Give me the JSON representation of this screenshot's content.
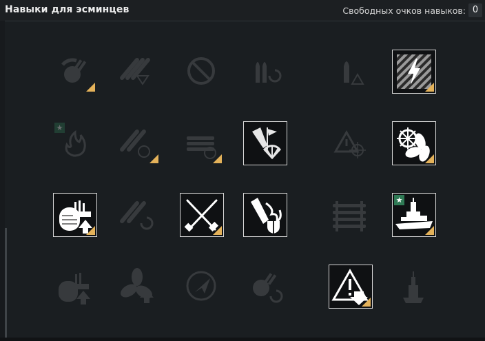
{
  "header": {
    "title": "Навыки для эсминцев",
    "points_label": "Свободных очков навыков:",
    "points_value": "0"
  },
  "colors": {
    "background": "#1a1e21",
    "learned_border": "#d9d9d9",
    "corner_marker": "#e4b25a",
    "star_badge": "#2f7a55"
  },
  "skills": [
    {
      "id": "r1c1",
      "icon": "aa-gunner-swing-icon",
      "learned": false,
      "corner": true,
      "star": false
    },
    {
      "id": "r1c2",
      "icon": "torpedo-triple-arrow-icon",
      "learned": false,
      "corner": false,
      "star": false
    },
    {
      "id": "r1c3",
      "icon": "prohibited-circle-icon",
      "learned": false,
      "corner": false,
      "star": false
    },
    {
      "id": "r1c4",
      "icon": "shells-reload-icon",
      "learned": false,
      "corner": false,
      "star": false
    },
    {
      "id": "r1c5",
      "icon": "shell-warning-icon",
      "learned": false,
      "corner": false,
      "star": false
    },
    {
      "id": "r1c6",
      "icon": "lightning-hazard-icon",
      "learned": true,
      "corner": true,
      "star": false
    },
    {
      "id": "r2c1",
      "icon": "fire-star-icon",
      "learned": false,
      "corner": false,
      "star": true
    },
    {
      "id": "r2c2",
      "icon": "torpedo-timer-icon",
      "learned": false,
      "corner": true,
      "star": false
    },
    {
      "id": "r2c3",
      "icon": "tubes-timer-icon",
      "learned": false,
      "corner": true,
      "star": false
    },
    {
      "id": "r2c4",
      "icon": "shell-flag-fan-icon",
      "learned": true,
      "corner": false,
      "star": false
    },
    {
      "id": "r2c5",
      "icon": "warning-crosshair-icon",
      "learned": false,
      "corner": false,
      "star": false
    },
    {
      "id": "r2c6",
      "icon": "helm-propeller-icon",
      "learned": true,
      "corner": true,
      "star": false
    },
    {
      "id": "r3c1",
      "icon": "aa-gunner-upgrade-icon",
      "learned": true,
      "corner": true,
      "star": false
    },
    {
      "id": "r3c2",
      "icon": "torpedo-reload-icon",
      "learned": false,
      "corner": false,
      "star": false
    },
    {
      "id": "r3c3",
      "icon": "crossed-tools-icon",
      "learned": true,
      "corner": true,
      "star": false
    },
    {
      "id": "r3c4",
      "icon": "shell-fire-shield-icon",
      "learned": true,
      "corner": false,
      "star": false
    },
    {
      "id": "r3c5",
      "icon": "tubes-stack-icon",
      "learned": false,
      "corner": false,
      "star": false
    },
    {
      "id": "r3c6",
      "icon": "battleship-star-icon",
      "learned": true,
      "corner": true,
      "star": true
    },
    {
      "id": "r4c1",
      "icon": "aa-upgrade-icon",
      "learned": false,
      "corner": false,
      "star": false
    },
    {
      "id": "r4c2",
      "icon": "propeller-upgrade-icon",
      "learned": false,
      "corner": false,
      "star": false
    },
    {
      "id": "r4c3",
      "icon": "radar-arrow-icon",
      "learned": false,
      "corner": false,
      "star": false
    },
    {
      "id": "r4c4",
      "icon": "aa-swing-reload-icon",
      "learned": false,
      "corner": false,
      "star": false
    },
    {
      "id": "r4c5",
      "icon": "warning-down-arrow-icon",
      "learned": true,
      "corner": true,
      "star": false
    },
    {
      "id": "r4c6",
      "icon": "ship-silhouette-icon",
      "learned": false,
      "corner": false,
      "star": false
    }
  ]
}
